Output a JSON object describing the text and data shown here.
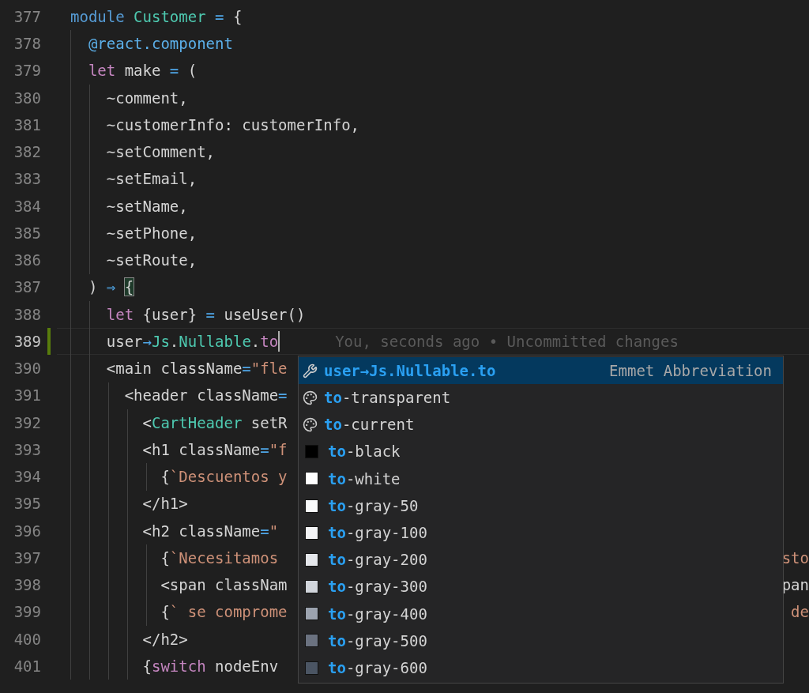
{
  "editor": {
    "lines": [
      {
        "number": "377",
        "current": false,
        "modified": false,
        "tokens": [
          {
            "kind": "keyword",
            "text": "module "
          },
          {
            "kind": "type",
            "text": "Customer"
          },
          {
            "kind": "operator",
            "text": " = "
          },
          {
            "kind": "plain",
            "text": "{"
          }
        ]
      },
      {
        "number": "378",
        "current": false,
        "modified": false,
        "tokens": [
          {
            "kind": "decorator",
            "text": "  @react.component"
          }
        ]
      },
      {
        "number": "379",
        "current": false,
        "modified": false,
        "tokens": [
          {
            "kind": "control",
            "text": "  let"
          },
          {
            "kind": "plain",
            "text": " make "
          },
          {
            "kind": "operator",
            "text": "="
          },
          {
            "kind": "plain",
            "text": " ("
          }
        ]
      },
      {
        "number": "380",
        "current": false,
        "modified": false,
        "tokens": [
          {
            "kind": "plain",
            "text": "    ~comment,"
          }
        ]
      },
      {
        "number": "381",
        "current": false,
        "modified": false,
        "tokens": [
          {
            "kind": "plain",
            "text": "    ~customerInfo: customerInfo,"
          }
        ]
      },
      {
        "number": "382",
        "current": false,
        "modified": false,
        "tokens": [
          {
            "kind": "plain",
            "text": "    ~setComment,"
          }
        ]
      },
      {
        "number": "383",
        "current": false,
        "modified": false,
        "tokens": [
          {
            "kind": "plain",
            "text": "    ~setEmail,"
          }
        ]
      },
      {
        "number": "384",
        "current": false,
        "modified": false,
        "tokens": [
          {
            "kind": "plain",
            "text": "    ~setName,"
          }
        ]
      },
      {
        "number": "385",
        "current": false,
        "modified": false,
        "tokens": [
          {
            "kind": "plain",
            "text": "    ~setPhone,"
          }
        ]
      },
      {
        "number": "386",
        "current": false,
        "modified": false,
        "tokens": [
          {
            "kind": "plain",
            "text": "    ~setRoute,"
          }
        ]
      },
      {
        "number": "387",
        "current": false,
        "modified": false,
        "tokens": [
          {
            "kind": "plain",
            "text": "  )"
          },
          {
            "kind": "operator",
            "text": " ⇒ "
          },
          {
            "kind": "bracket_match",
            "text": "{"
          }
        ]
      },
      {
        "number": "388",
        "current": false,
        "modified": false,
        "tokens": [
          {
            "kind": "control",
            "text": "    let"
          },
          {
            "kind": "plain",
            "text": " {user} "
          },
          {
            "kind": "operator",
            "text": "="
          },
          {
            "kind": "plain",
            "text": " useUser()"
          }
        ]
      },
      {
        "number": "389",
        "current": true,
        "modified": true,
        "cursor": true,
        "blame": "You, seconds ago • Uncommitted changes",
        "tokens": [
          {
            "kind": "plain",
            "text": "    user"
          },
          {
            "kind": "operator",
            "text": "→"
          },
          {
            "kind": "type",
            "text": "Js"
          },
          {
            "kind": "plain",
            "text": "."
          },
          {
            "kind": "type",
            "text": "Nullable"
          },
          {
            "kind": "plain",
            "text": "."
          },
          {
            "kind": "control",
            "text": "to"
          }
        ]
      },
      {
        "number": "390",
        "current": false,
        "modified": false,
        "tokens": [
          {
            "kind": "plain",
            "text": "    <main className"
          },
          {
            "kind": "operator",
            "text": "="
          },
          {
            "kind": "string",
            "text": "\"fle"
          }
        ]
      },
      {
        "number": "391",
        "current": false,
        "modified": false,
        "tokens": [
          {
            "kind": "plain",
            "text": "      <header className"
          },
          {
            "kind": "operator",
            "text": "="
          }
        ]
      },
      {
        "number": "392",
        "current": false,
        "modified": false,
        "tokens": [
          {
            "kind": "plain",
            "text": "        <"
          },
          {
            "kind": "type",
            "text": "CartHeader"
          },
          {
            "kind": "plain",
            "text": " setR"
          }
        ]
      },
      {
        "number": "393",
        "current": false,
        "modified": false,
        "tokens": [
          {
            "kind": "plain",
            "text": "        <h1 className"
          },
          {
            "kind": "operator",
            "text": "="
          },
          {
            "kind": "string",
            "text": "\"f"
          }
        ]
      },
      {
        "number": "394",
        "current": false,
        "modified": false,
        "tokens": [
          {
            "kind": "plain",
            "text": "          {"
          },
          {
            "kind": "string",
            "text": "`Descuentos y"
          }
        ]
      },
      {
        "number": "395",
        "current": false,
        "modified": false,
        "tokens": [
          {
            "kind": "plain",
            "text": "        </h1>"
          }
        ]
      },
      {
        "number": "396",
        "current": false,
        "modified": false,
        "tokens": [
          {
            "kind": "plain",
            "text": "        <h2 className"
          },
          {
            "kind": "operator",
            "text": "="
          },
          {
            "kind": "string",
            "text": "\""
          }
        ]
      },
      {
        "number": "397",
        "current": false,
        "modified": false,
        "tokens": [
          {
            "kind": "plain",
            "text": "          {"
          },
          {
            "kind": "string",
            "text": "`Necesitamos"
          }
        ],
        "tail": {
          "kind": "string",
          "text": "sto"
        }
      },
      {
        "number": "398",
        "current": false,
        "modified": false,
        "tokens": [
          {
            "kind": "plain",
            "text": "          <span classNam"
          }
        ],
        "tail": {
          "kind": "plain",
          "text": "pan"
        }
      },
      {
        "number": "399",
        "current": false,
        "modified": false,
        "tokens": [
          {
            "kind": "plain",
            "text": "          {"
          },
          {
            "kind": "string",
            "text": "` se comprome"
          }
        ],
        "tail": {
          "kind": "string",
          "text": "de"
        }
      },
      {
        "number": "400",
        "current": false,
        "modified": false,
        "tokens": [
          {
            "kind": "plain",
            "text": "        </h2>"
          }
        ]
      },
      {
        "number": "401",
        "current": false,
        "modified": false,
        "tokens": [
          {
            "kind": "plain",
            "text": "        {"
          },
          {
            "kind": "control",
            "text": "switch"
          },
          {
            "kind": "plain",
            "text": " nodeEnv"
          }
        ]
      }
    ]
  },
  "suggestions": {
    "items": [
      {
        "kind": "emmet",
        "match": "user→Js.Nullable.to",
        "detail": "Emmet Abbreviation",
        "selected": true
      },
      {
        "kind": "keyword",
        "match": "to",
        "rest": "-transparent",
        "selected": false
      },
      {
        "kind": "keyword",
        "match": "to",
        "rest": "-current",
        "selected": false
      },
      {
        "kind": "color",
        "color": "#000000",
        "match": "to",
        "rest": "-black",
        "selected": false
      },
      {
        "kind": "color",
        "color": "#ffffff",
        "match": "to",
        "rest": "-white",
        "selected": false
      },
      {
        "kind": "color",
        "color": "#f9fafb",
        "match": "to",
        "rest": "-gray-50",
        "selected": false
      },
      {
        "kind": "color",
        "color": "#f3f4f6",
        "match": "to",
        "rest": "-gray-100",
        "selected": false
      },
      {
        "kind": "color",
        "color": "#e5e7eb",
        "match": "to",
        "rest": "-gray-200",
        "selected": false
      },
      {
        "kind": "color",
        "color": "#d1d5db",
        "match": "to",
        "rest": "-gray-300",
        "selected": false
      },
      {
        "kind": "color",
        "color": "#9ca3af",
        "match": "to",
        "rest": "-gray-400",
        "selected": false
      },
      {
        "kind": "color",
        "color": "#6b7280",
        "match": "to",
        "rest": "-gray-500",
        "selected": false
      },
      {
        "kind": "color",
        "color": "#4b5563",
        "match": "to",
        "rest": "-gray-600",
        "selected": false
      }
    ]
  }
}
